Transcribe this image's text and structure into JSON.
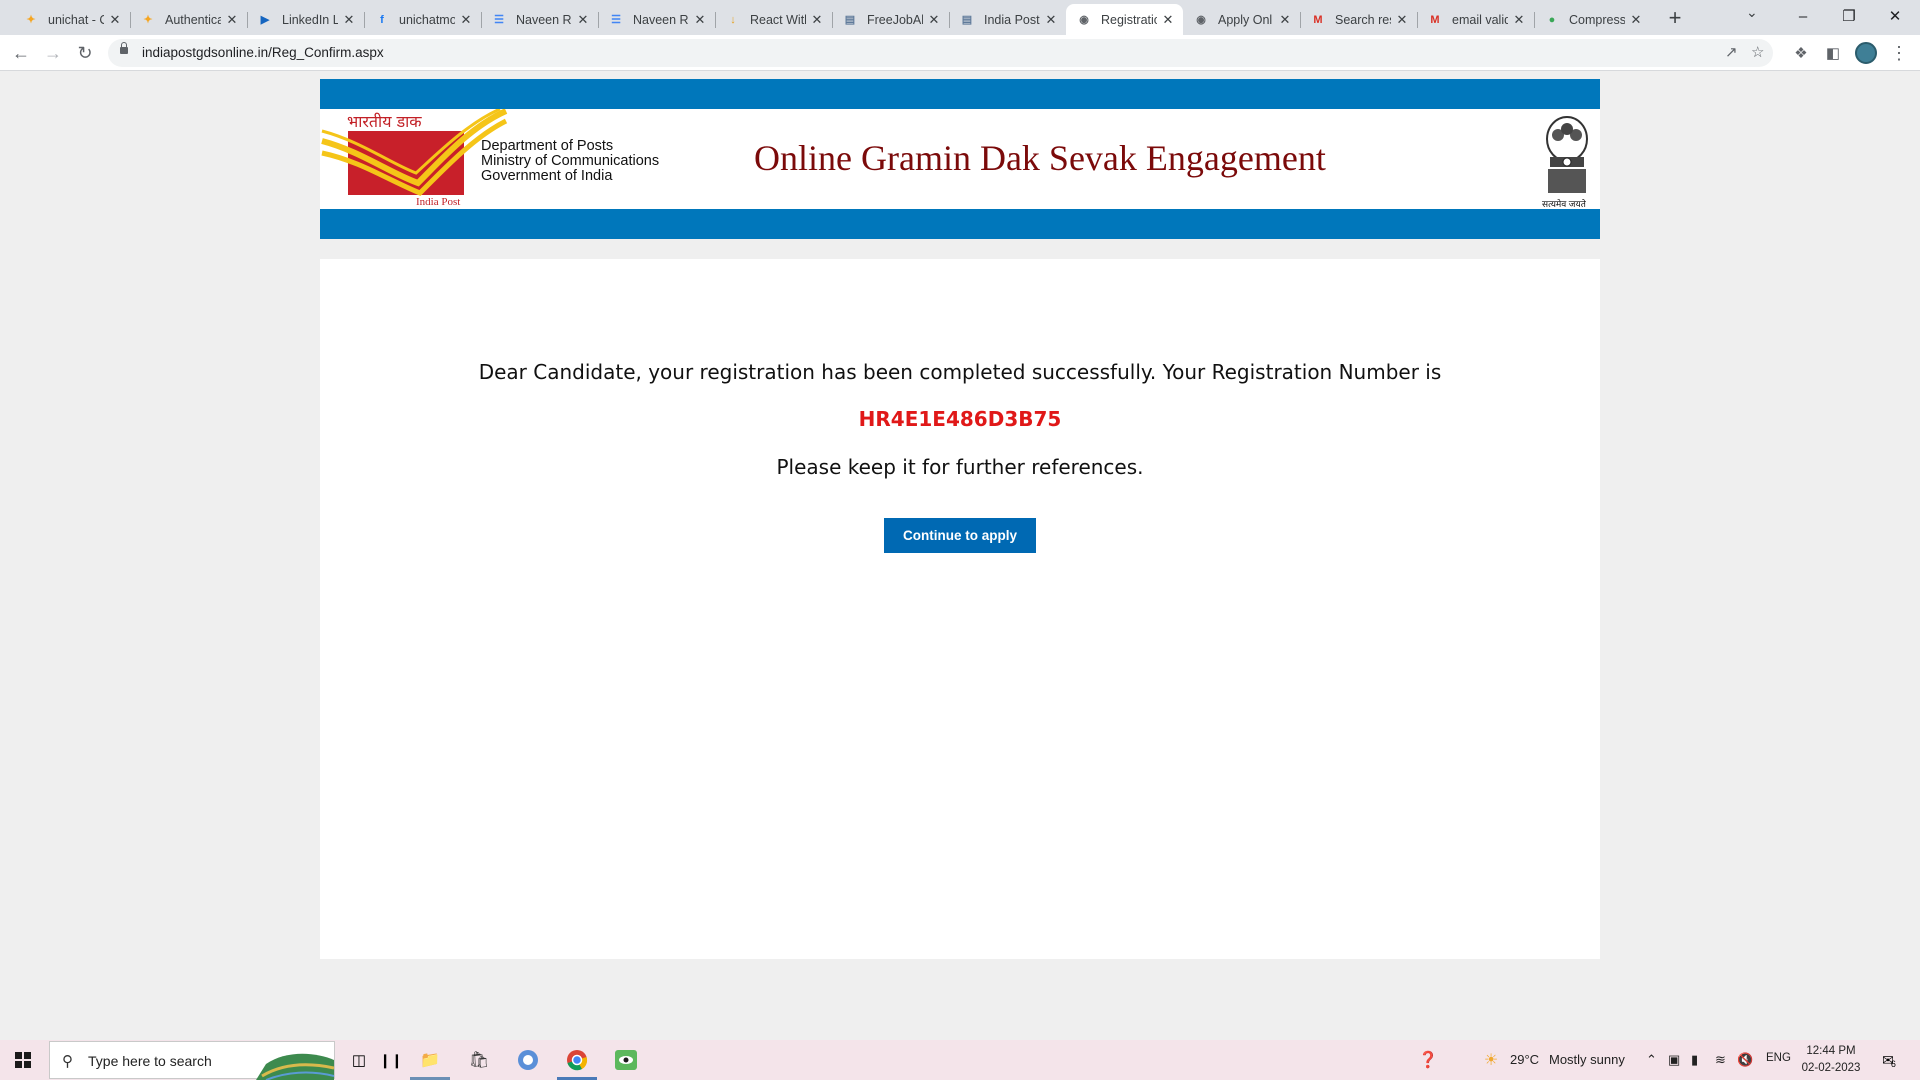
{
  "browser": {
    "tabs": [
      {
        "title": "unichat - C",
        "favicon": "unichat-icon",
        "favicon_color": "#f5a623"
      },
      {
        "title": "Authenticat",
        "favicon": "unichat-icon",
        "favicon_color": "#f5a623"
      },
      {
        "title": "LinkedIn L",
        "favicon": "youtube-play-icon",
        "favicon_color": "#1565c0"
      },
      {
        "title": "unichatmo",
        "favicon": "facebook-icon",
        "favicon_color": "#1877f2"
      },
      {
        "title": "Naveen Ra",
        "favicon": "docs-icon",
        "favicon_color": "#4285f4"
      },
      {
        "title": "Naveen Ra",
        "favicon": "docs-icon",
        "favicon_color": "#4285f4"
      },
      {
        "title": "React With",
        "favicon": "bolt-icon",
        "favicon_color": "#e6a11f"
      },
      {
        "title": "FreeJobAle",
        "favicon": "page-icon",
        "favicon_color": "#5f7a9a"
      },
      {
        "title": "India Post",
        "favicon": "page-icon",
        "favicon_color": "#5f7a9a"
      },
      {
        "title": "Registratio",
        "favicon": "globe-icon",
        "favicon_color": "#5f6368"
      },
      {
        "title": "Apply Onl",
        "favicon": "globe-icon",
        "favicon_color": "#5f6368"
      },
      {
        "title": "Search res",
        "favicon": "gmail-icon",
        "favicon_color": "#d93025"
      },
      {
        "title": "email valid",
        "favicon": "gmail-icon",
        "favicon_color": "#d93025"
      },
      {
        "title": "Compress",
        "favicon": "compress-icon",
        "favicon_color": "#3aa757"
      }
    ],
    "active_tab_index": 9,
    "url": "indiapostgdsonline.in/Reg_Confirm.aspx"
  },
  "header": {
    "logo_hindi": "भारतीय डाक",
    "logo_english": "India Post",
    "dept_line1": "Department of Posts",
    "dept_line2": "Ministry of Communications",
    "dept_line3": "Government of India",
    "title": "Online Gramin Dak Sevak Engagement",
    "emblem_motto": "सत्यमेव जयते"
  },
  "confirmation": {
    "message": "Dear Candidate, your registration has been completed successfully. Your Registration Number is",
    "registration_number": "HR4E1E486D3B75",
    "note": "Please keep it for further references.",
    "button_label": "Continue to apply"
  },
  "taskbar": {
    "search_placeholder": "Type here to search",
    "weather_temp": "29°C",
    "weather_desc": "Mostly sunny",
    "language": "ENG",
    "time": "12:44 PM",
    "date": "02-02-2023",
    "notification_count": "6"
  },
  "colors": {
    "brand_blue": "#0077bb",
    "title_maroon": "#7b0a0a",
    "reg_red": "#e01818",
    "button_blue": "#0069b3"
  }
}
